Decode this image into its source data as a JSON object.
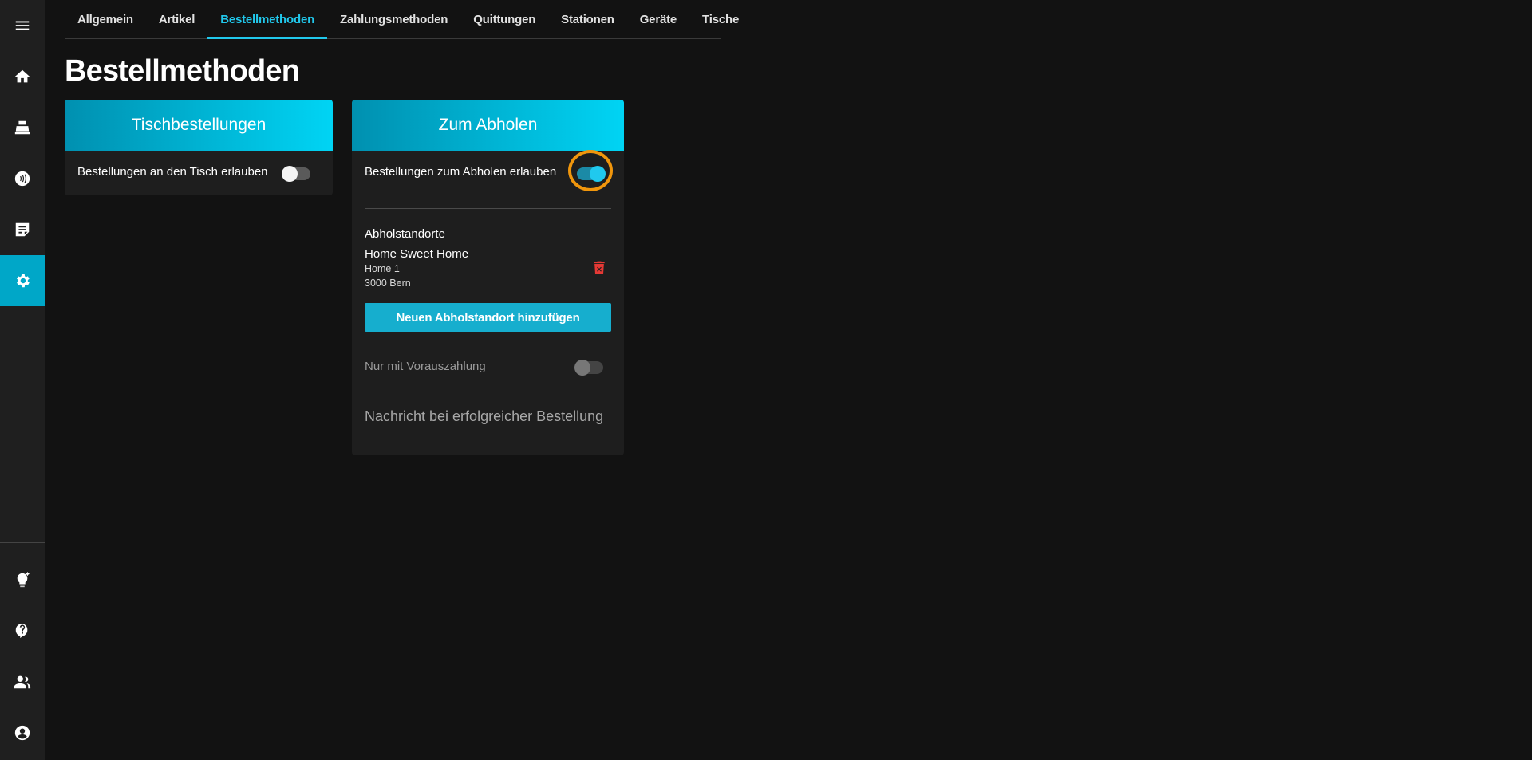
{
  "tabs": [
    {
      "label": "Allgemein"
    },
    {
      "label": "Artikel"
    },
    {
      "label": "Bestellmethoden",
      "active": true
    },
    {
      "label": "Zahlungsmethoden"
    },
    {
      "label": "Quittungen"
    },
    {
      "label": "Stationen"
    },
    {
      "label": "Geräte"
    },
    {
      "label": "Tische"
    }
  ],
  "page": {
    "title": "Bestellmethoden"
  },
  "sidebar": {
    "items": [
      {
        "icon": "menu-icon"
      },
      {
        "icon": "home-icon"
      },
      {
        "icon": "cash-register-icon"
      },
      {
        "icon": "contactless-payment-icon"
      },
      {
        "icon": "orders-note-icon"
      },
      {
        "icon": "settings-gear-icon",
        "active": true
      },
      {
        "icon": "lightbulb-icon"
      },
      {
        "icon": "help-icon"
      },
      {
        "icon": "users-icon"
      },
      {
        "icon": "account-icon"
      }
    ]
  },
  "table_orders": {
    "title": "Tischbestellungen",
    "allow_label": "Bestellungen an den Tisch erlauben",
    "allow_enabled": false
  },
  "pickup": {
    "title": "Zum Abholen",
    "allow_label": "Bestellungen zum Abholen erlauben",
    "allow_enabled": true,
    "locations_heading": "Abholstandorte",
    "locations": [
      {
        "name": "Home Sweet Home",
        "street": "Home 1",
        "city": "3000 Bern"
      }
    ],
    "add_location_label": "Neuen Abholstandort hinzufügen",
    "prepayment_label": "Nur mit Vorauszahlung",
    "prepayment_enabled": false,
    "success_message_placeholder": "Nachricht bei erfolgreicher Bestellung"
  },
  "colors": {
    "accent": "#21c8ec",
    "highlight": "#f0960c",
    "delete": "#e53935"
  }
}
